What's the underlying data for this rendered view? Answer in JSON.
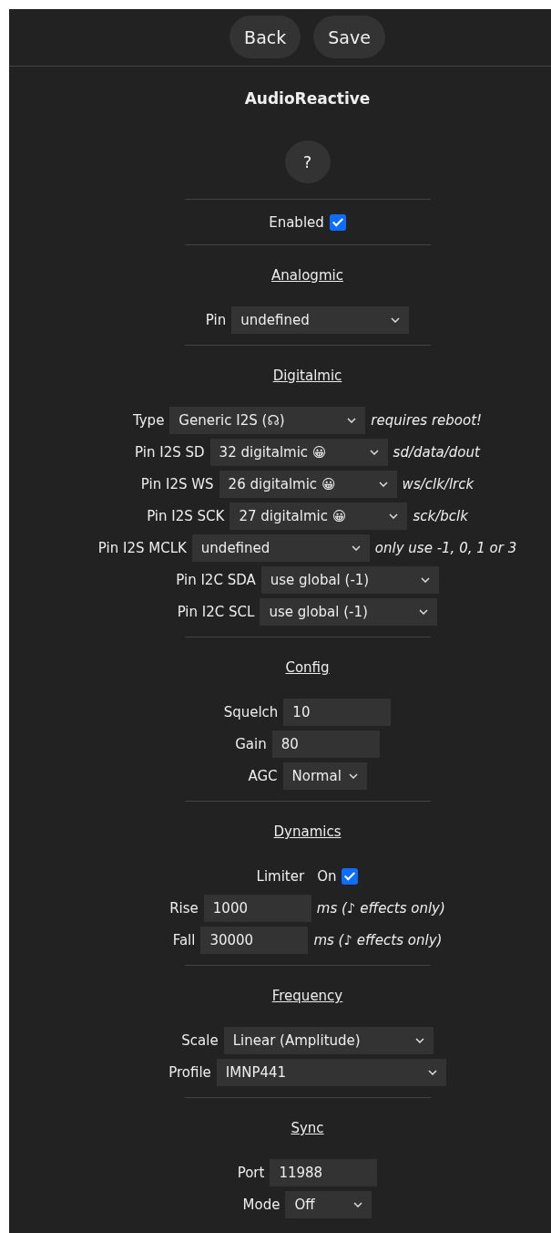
{
  "nav": {
    "buttons": [
      "Back",
      "Save"
    ]
  },
  "title": "AudioReactive",
  "help_button": "?",
  "enabled": {
    "label": "Enabled",
    "checked": true
  },
  "sections": [
    {
      "heading": "Analogmic",
      "rows": [
        {
          "kind": "select",
          "label": "Pin",
          "value": "undefined"
        }
      ]
    },
    {
      "heading": "Digitalmic",
      "rows": [
        {
          "kind": "select",
          "label": "Type",
          "value": "Generic I2S (☊)",
          "note": "requires reboot!"
        },
        {
          "kind": "select",
          "label": "Pin I2S SD",
          "value": "32 digitalmic 😀",
          "note": "sd/data/dout"
        },
        {
          "kind": "select",
          "label": "Pin I2S WS",
          "value": "26 digitalmic 😀",
          "note": "ws/clk/lrck"
        },
        {
          "kind": "select",
          "label": "Pin I2S SCK",
          "value": "27 digitalmic 😀",
          "note": "sck/bclk"
        },
        {
          "kind": "select",
          "label": "Pin I2S MCLK",
          "value": "undefined",
          "note": "only use -1, 0, 1 or 3"
        },
        {
          "kind": "select",
          "label": "Pin I2C SDA",
          "value": "use global (-1)"
        },
        {
          "kind": "select",
          "label": "Pin I2C SCL",
          "value": "use global (-1)"
        }
      ]
    },
    {
      "heading": "Config",
      "rows": [
        {
          "kind": "input",
          "label": "Squelch",
          "value": "10"
        },
        {
          "kind": "input",
          "label": "Gain",
          "value": "80"
        },
        {
          "kind": "select",
          "label": "AGC",
          "value": "Normal"
        }
      ]
    },
    {
      "heading": "Dynamics",
      "rows": [
        {
          "kind": "checkbox",
          "label": "Limiter",
          "text": "On",
          "checked": true
        },
        {
          "kind": "input",
          "label": "Rise",
          "value": "1000",
          "note": "ms *(♪ effects only)*"
        },
        {
          "kind": "input",
          "label": "Fall",
          "value": "30000",
          "note": "ms *(♪ effects only)*"
        }
      ]
    },
    {
      "heading": "Frequency",
      "rows": [
        {
          "kind": "select",
          "label": "Scale",
          "value": "Linear (Amplitude)"
        },
        {
          "kind": "select",
          "label": "Profile",
          "value": "IMNP441"
        }
      ]
    },
    {
      "heading": "Sync",
      "rows": [
        {
          "kind": "input",
          "label": "Port",
          "value": "11988"
        },
        {
          "kind": "select",
          "label": "Mode",
          "value": "Off"
        }
      ]
    }
  ]
}
